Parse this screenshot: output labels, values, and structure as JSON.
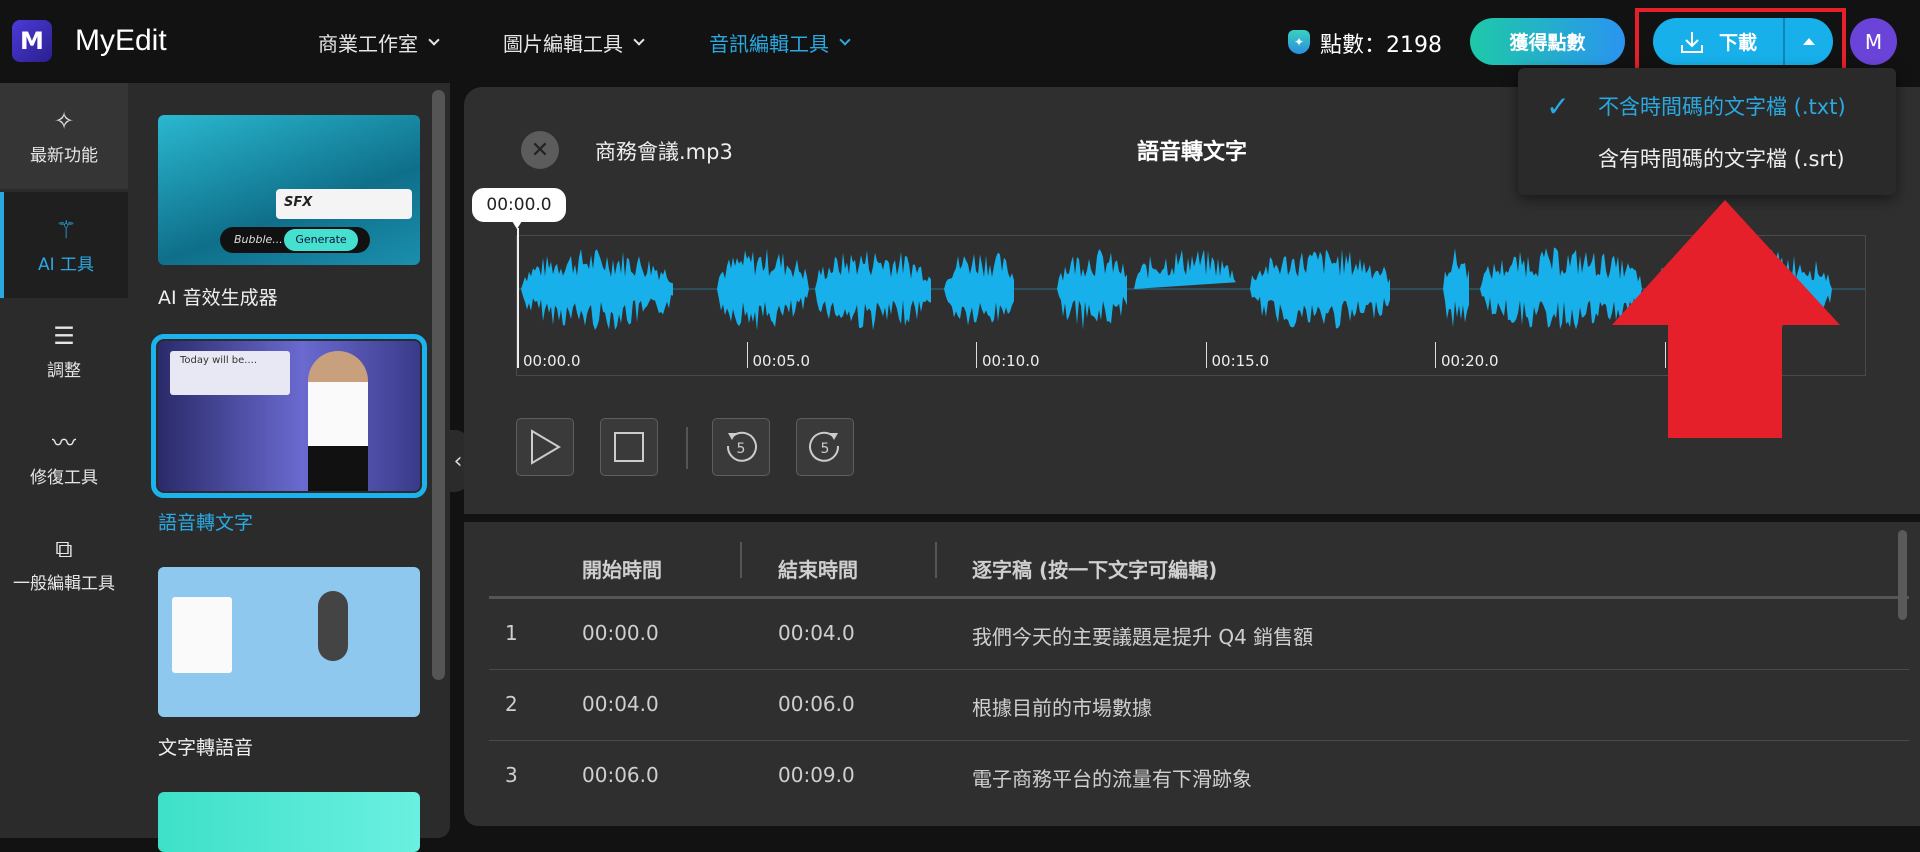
{
  "header": {
    "brand": "MyEdit",
    "logo_letter": "M",
    "nav": [
      {
        "label": "商業工作室",
        "active": false
      },
      {
        "label": "圖片編輯工具",
        "active": false
      },
      {
        "label": "音訊編輯工具",
        "active": true
      }
    ],
    "points_label": "點數：2198",
    "get_points_label": "獲得點數",
    "download_label": "下載",
    "avatar_letter": "M"
  },
  "download_menu": {
    "items": [
      {
        "label": "不含時間碼的文字檔 (.txt)",
        "selected": true
      },
      {
        "label": "含有時間碼的文字檔 (.srt)",
        "selected": false
      }
    ]
  },
  "rail": {
    "items": [
      {
        "label": "最新功能",
        "icon": "sparkle-icon"
      },
      {
        "label": "AI 工具",
        "icon": "magic-wand-icon",
        "active": true
      },
      {
        "label": "調整",
        "icon": "sliders-icon"
      },
      {
        "label": "修復工具",
        "icon": "waveform-icon"
      },
      {
        "label": "一般編輯工具",
        "icon": "layers-icon"
      }
    ]
  },
  "tools": {
    "cards": [
      {
        "label": "AI 音效生成器",
        "thumb_text_1": "SFX",
        "thumb_text_2": "Bubble...",
        "thumb_text_3": "Generate"
      },
      {
        "label": "語音轉文字",
        "selected": true,
        "thumb_text_1": "Today will be...."
      },
      {
        "label": "文字轉語音"
      }
    ]
  },
  "editor": {
    "file_name": "商務會議.mp3",
    "title": "語音轉文字",
    "current_time": "00:00.0",
    "timeline_ticks": [
      "00:00.0",
      "00:05.0",
      "00:10.0",
      "00:15.0",
      "00:20.0",
      ""
    ],
    "accent": "#17b0ea"
  },
  "transcript": {
    "headers": [
      "開始時間",
      "結束時間",
      "逐字稿 (按一下文字可編輯)"
    ],
    "rows": [
      {
        "index": "1",
        "start": "00:00.0",
        "end": "00:04.0",
        "text": "我們今天的主要議題是提升 Q4 銷售額"
      },
      {
        "index": "2",
        "start": "00:04.0",
        "end": "00:06.0",
        "text": "根據目前的市場數據"
      },
      {
        "index": "3",
        "start": "00:06.0",
        "end": "00:09.0",
        "text": "電子商務平台的流量有下滑跡象"
      }
    ]
  }
}
